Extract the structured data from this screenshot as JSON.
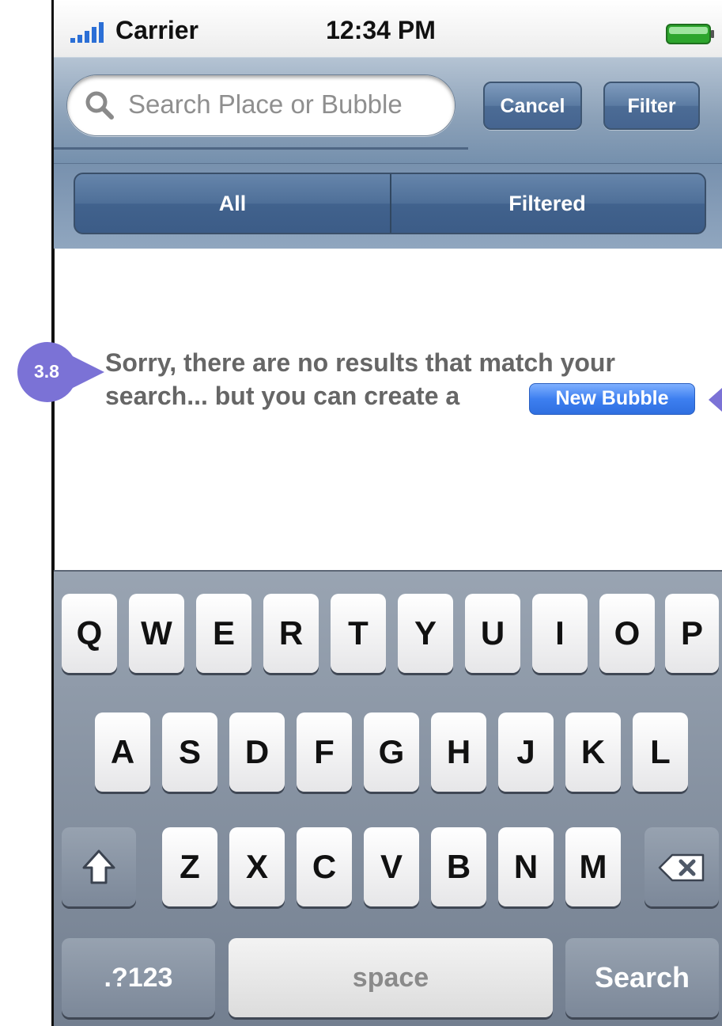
{
  "status_bar": {
    "carrier": "Carrier",
    "time": "12:34 PM"
  },
  "search": {
    "placeholder": "Search Place or Bubble",
    "cancel_label": "Cancel",
    "filter_label": "Filter"
  },
  "scope": {
    "segments": [
      "All",
      "Filtered"
    ]
  },
  "annotation": {
    "badge": "3.8"
  },
  "message": {
    "line1": "Sorry, there are no results that match your",
    "line2": "search... but you can create a",
    "new_bubble_label": "New Bubble"
  },
  "keyboard": {
    "row1": [
      "Q",
      "W",
      "E",
      "R",
      "T",
      "Y",
      "U",
      "I",
      "O",
      "P"
    ],
    "row2": [
      "A",
      "S",
      "D",
      "F",
      "G",
      "H",
      "J",
      "K",
      "L"
    ],
    "row3": [
      "Z",
      "X",
      "C",
      "V",
      "B",
      "N",
      "M"
    ],
    "numbers_label": ".?123",
    "space_label": "space",
    "search_label": "Search",
    "shift_icon": "shift-icon",
    "backspace_icon": "backspace-icon"
  },
  "colors": {
    "nav_bar": "#8da2b9",
    "accent_button": "#3d7ff0",
    "badge": "#7b72d6"
  }
}
